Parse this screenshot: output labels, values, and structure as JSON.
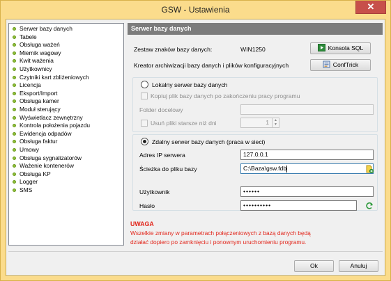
{
  "window": {
    "title": "GSW - Ustawienia",
    "close_glyph": "✕",
    "frame_color": "#fbdc8c"
  },
  "sidebar": {
    "items": [
      "Serwer bazy danych",
      "Tabele",
      "Obsługa ważeń",
      "Miernik wagowy",
      "Kwit ważenia",
      "Użytkownicy",
      "Czytniki kart zbliżeniowych",
      "Licencja",
      "Eksport/Import",
      "Obsługa kamer",
      "Moduł sterujący",
      "Wyświetlacz zewnętrzny",
      "Kontrola położenia pojazdu",
      "Ewidencja odpadów",
      "Obsługa faktur",
      "Umowy",
      "Obsługa sygnalizatorów",
      "Ważenie kontenerów",
      "Obsługa KP",
      "Logger",
      "SMS"
    ],
    "bullet_color": "#8fbf3a"
  },
  "panel": {
    "header": "Serwer bazy danych",
    "charset_label": "Zestaw znaków bazy danych:",
    "charset_value": "WIN1250",
    "sql_console_button": "Konsola SQL",
    "archive_label": "Kreator archiwizacji bazy danych i plików konfiguracyjnych",
    "conftrick_button": "ConfTrick",
    "local": {
      "radio_label": "Lokalny serwer bazy danych",
      "selected": false,
      "copy_checkbox": "Kopiuj plik bazy danych po zakończeniu pracy programu",
      "folder_label": "Folder docelowy",
      "folder_value": "",
      "delete_checkbox": "Usuń pliki starsze niż dni",
      "days_value": "1"
    },
    "remote": {
      "radio_label": "Zdalny serwer bazy danych (praca w sieci)",
      "selected": true,
      "ip_label": "Adres IP serwera",
      "ip_value": "127.0.0.1",
      "path_label": "Ścieżka do pliku bazy",
      "path_value": "C:\\Baza\\gsw.fdb",
      "user_label": "Użytkownik",
      "user_value": "••••••",
      "password_label": "Hasło",
      "password_value": "••••••••••"
    },
    "warning": {
      "title": "UWAGA",
      "line1": "Wszelkie zmiany w parametrach połączeniowych z bazą danych będą",
      "line2": "działać dopiero po zamknięciu i ponownym uruchomieniu programu.",
      "color": "#e2261b"
    }
  },
  "footer": {
    "ok_button": "Ok",
    "cancel_button": "Anuluj"
  },
  "icons": {
    "console": "console-play-icon",
    "conftrick": "conftrick-icon",
    "browse": "browse-file-icon",
    "refresh": "refresh-icon"
  }
}
